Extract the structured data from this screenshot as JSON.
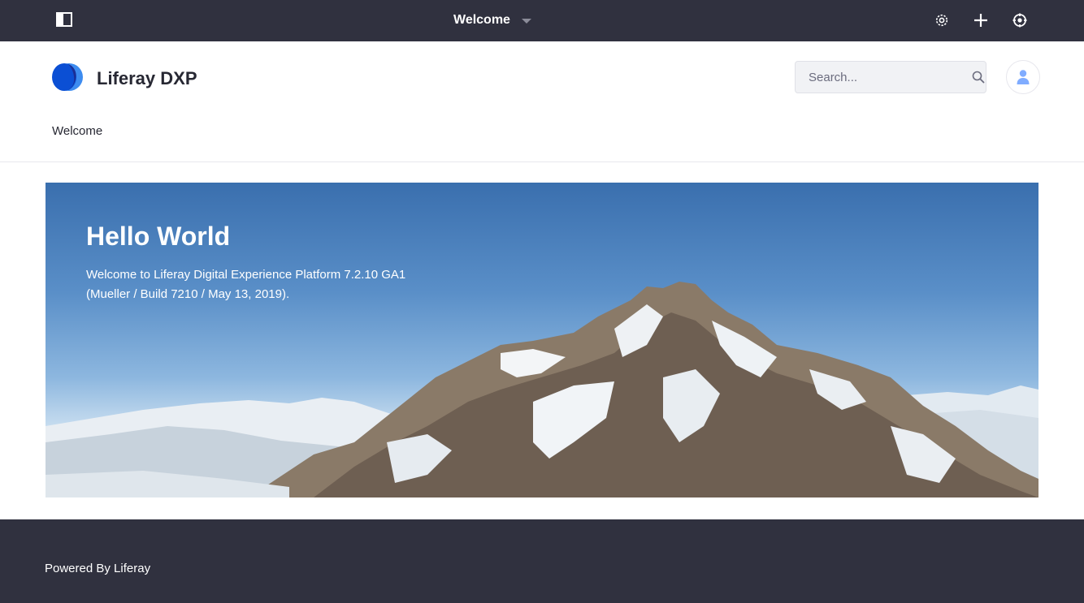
{
  "control_menu": {
    "title": "Welcome",
    "icons": {
      "toggle": "product-menu-icon",
      "settings": "gear-icon",
      "add": "plus-icon",
      "simulation": "simulation-icon"
    }
  },
  "header": {
    "site_name": "Liferay DXP",
    "search": {
      "placeholder": "Search...",
      "value": ""
    },
    "nav": [
      {
        "label": "Welcome"
      }
    ]
  },
  "banner": {
    "title": "Hello World",
    "text_line1": "Welcome to Liferay Digital Experience Platform 7.2.10 GA1",
    "text_line2": "(Mueller / Build 7210 / May 13, 2019)."
  },
  "footer": {
    "text": "Powered By Liferay"
  },
  "colors": {
    "control_bar": "#30313f",
    "footer": "#30313f",
    "brand_blue": "#0b5fff",
    "avatar_icon": "#80acff"
  }
}
